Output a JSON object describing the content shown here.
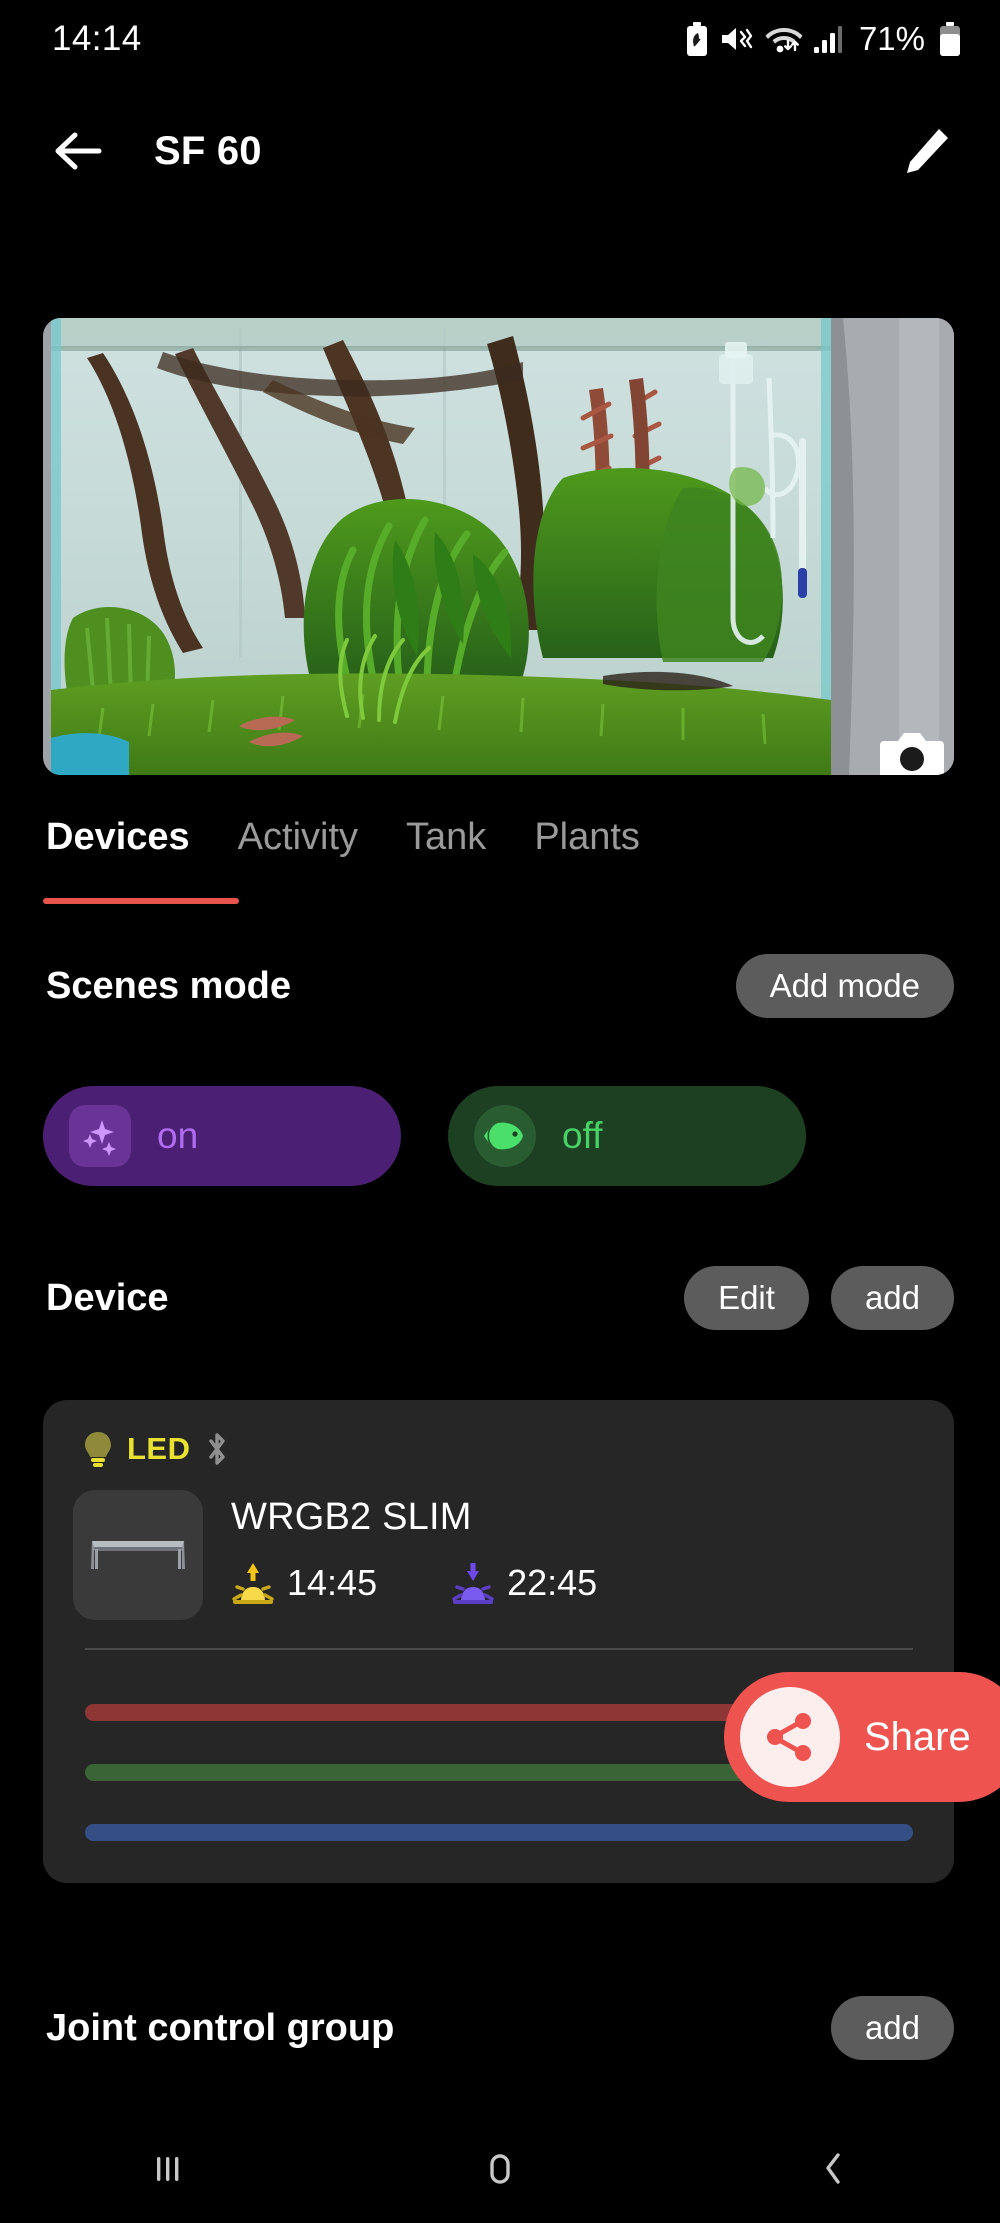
{
  "status_bar": {
    "time": "14:14",
    "battery_percent": "71%",
    "icons": [
      "battery-saver-icon",
      "mute-vibrate-icon",
      "wifi-icon",
      "cellular-signal-icon",
      "battery-icon"
    ]
  },
  "app_bar": {
    "back_icon": "back-arrow-icon",
    "title": "SF 60",
    "edit_icon": "pencil-edit-icon"
  },
  "hero": {
    "alt": "planted aquarium photo",
    "camera_icon": "camera-icon"
  },
  "tabs": {
    "items": [
      {
        "label": "Devices",
        "active": true
      },
      {
        "label": "Activity",
        "active": false
      },
      {
        "label": "Tank",
        "active": false
      },
      {
        "label": "Plants",
        "active": false
      }
    ],
    "indicator_color": "#e8534c"
  },
  "scenes_section": {
    "title": "Scenes mode",
    "add_label": "Add mode",
    "modes": [
      {
        "label": "on",
        "icon": "sparkles-icon",
        "bg": "#4b1f73",
        "text_color": "#b06cf0"
      },
      {
        "label": "off",
        "icon": "fish-icon",
        "bg": "#1d4023",
        "text_color": "#46d264"
      }
    ]
  },
  "device_section": {
    "title": "Device",
    "edit_label": "Edit",
    "add_label": "add",
    "card": {
      "tag_label": "LED",
      "tag_color": "#e8e130",
      "bulb_icon": "lightbulb-icon",
      "bluetooth_icon": "bluetooth-icon",
      "thumbnail_icon": "led-light-bar-icon",
      "name": "WRGB2 SLIM",
      "sunrise_icon": "sunrise-icon",
      "sunrise_time": "14:45",
      "sunset_icon": "sunset-icon",
      "sunset_time": "22:45",
      "sliders": [
        {
          "channel": "red",
          "color": "#8e3535"
        },
        {
          "channel": "green",
          "color": "#3a6435"
        },
        {
          "channel": "blue",
          "color": "#354f85"
        }
      ]
    }
  },
  "share_fab": {
    "label": "Share",
    "icon": "share-icon",
    "bg": "#ef5350"
  },
  "joint_section": {
    "title": "Joint control group",
    "add_label": "add"
  },
  "nav_bar": {
    "recents_icon": "recents-icon",
    "home_icon": "home-icon",
    "back_icon": "nav-back-icon"
  }
}
